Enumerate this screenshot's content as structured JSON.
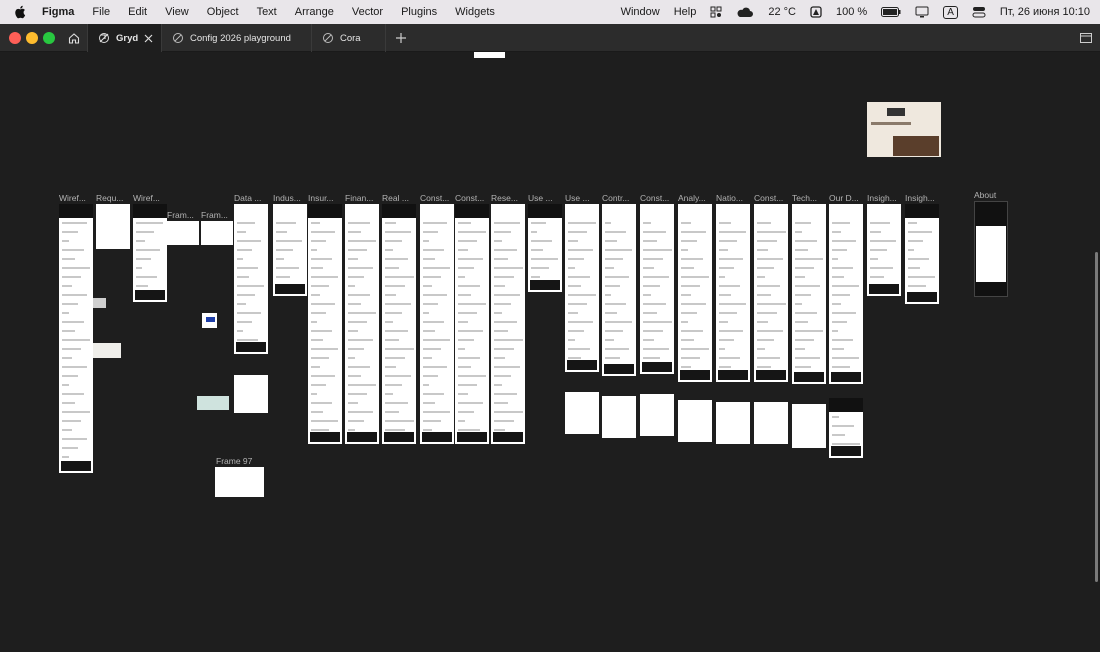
{
  "menubar": {
    "app": "Figma",
    "items": [
      "File",
      "Edit",
      "View",
      "Object",
      "Text",
      "Arrange",
      "Vector",
      "Plugins",
      "Widgets"
    ],
    "window": "Window",
    "help": "Help",
    "temperature": "22 °C",
    "battery": "100 %",
    "input_source": "A",
    "datetime": "Пт, 26 июня  10:10"
  },
  "tabs": [
    {
      "label": "Gryd",
      "active": true
    },
    {
      "label": "Config 2026 playground",
      "active": false
    },
    {
      "label": "Cora",
      "active": false
    }
  ],
  "canvas": {
    "frame_labels": [
      "Wiref...",
      "Requ...",
      "Wiref...",
      "Fram...",
      "Fram...",
      "Data ...",
      "Indus...",
      "Insur...",
      "Finan...",
      "Real ...",
      "Const...",
      "Const...",
      "Rese...",
      "Use ...",
      "Use ...",
      "Contr...",
      "Const...",
      "Analy...",
      "Natio...",
      "Const...",
      "Tech...",
      "Our D...",
      "Insigh...",
      "Insigh...",
      "About"
    ],
    "frame97_label": "Frame 97"
  }
}
